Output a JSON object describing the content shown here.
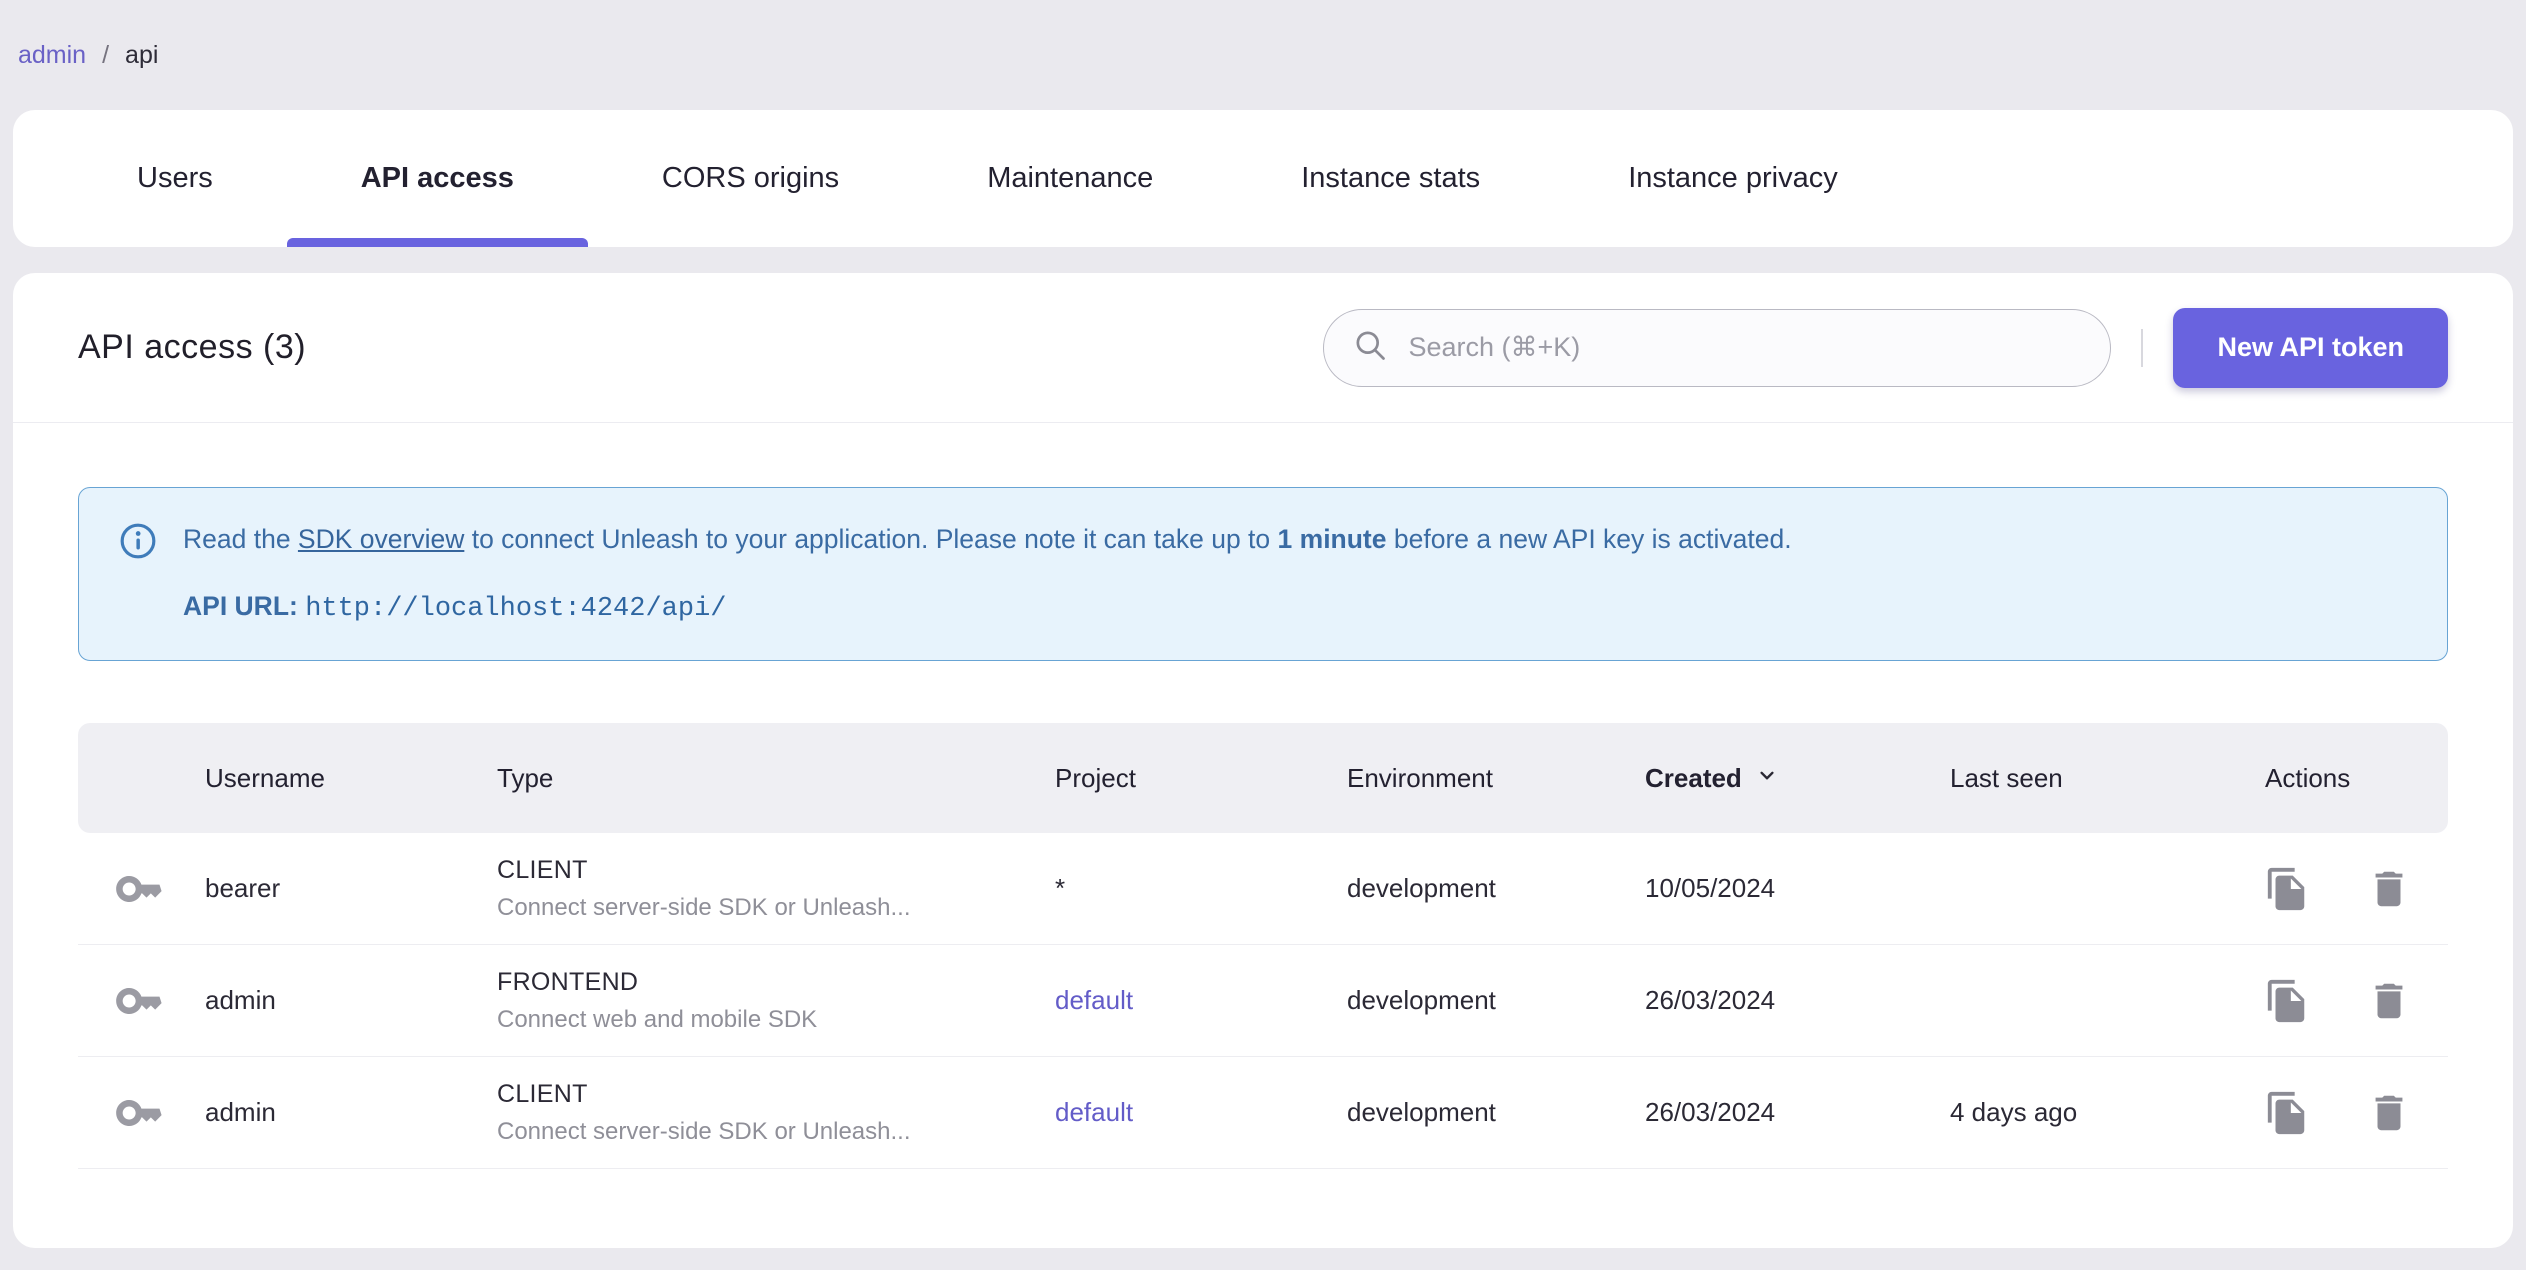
{
  "breadcrumb": {
    "admin": "admin",
    "separator": "/",
    "current": "api"
  },
  "tabs": [
    {
      "label": "Users",
      "active": false
    },
    {
      "label": "API access",
      "active": true
    },
    {
      "label": "CORS origins",
      "active": false
    },
    {
      "label": "Maintenance",
      "active": false
    },
    {
      "label": "Instance stats",
      "active": false
    },
    {
      "label": "Instance privacy",
      "active": false
    }
  ],
  "header": {
    "title": "API access (3)",
    "search_placeholder": "Search (⌘+K)",
    "new_token_button": "New API token"
  },
  "banner": {
    "text_prefix": "Read the ",
    "link_text": "SDK overview",
    "text_middle": " to connect Unleash to your application. Please note it can take up to ",
    "bold_text": "1 minute",
    "text_suffix": " before a new API key is activated.",
    "api_url_label": "API URL:",
    "api_url": "http://localhost:4242/api/"
  },
  "table": {
    "columns": [
      "Username",
      "Type",
      "Project",
      "Environment",
      "Created",
      "Last seen",
      "Actions"
    ],
    "sort_column": "Created",
    "rows": [
      {
        "username": "bearer",
        "type": "CLIENT",
        "type_description": "Connect server-side SDK or Unleash...",
        "project": "*",
        "environment": "development",
        "created": "10/05/2024",
        "last_seen": ""
      },
      {
        "username": "admin",
        "type": "FRONTEND",
        "type_description": "Connect web and mobile SDK",
        "project": "default",
        "environment": "development",
        "created": "26/03/2024",
        "last_seen": ""
      },
      {
        "username": "admin",
        "type": "CLIENT",
        "type_description": "Connect server-side SDK or Unleash...",
        "project": "default",
        "environment": "development",
        "created": "26/03/2024",
        "last_seen": "4 days ago"
      }
    ]
  },
  "colors": {
    "accent_purple": "#6963df",
    "link_purple": "#635cc8",
    "banner_background": "#e7f3fc",
    "banner_border": "#68a4d4",
    "banner_text": "#3a6ba3",
    "page_background": "#eae9ee",
    "table_header_background": "#efeff3",
    "icon_gray": "#8c8c95"
  }
}
